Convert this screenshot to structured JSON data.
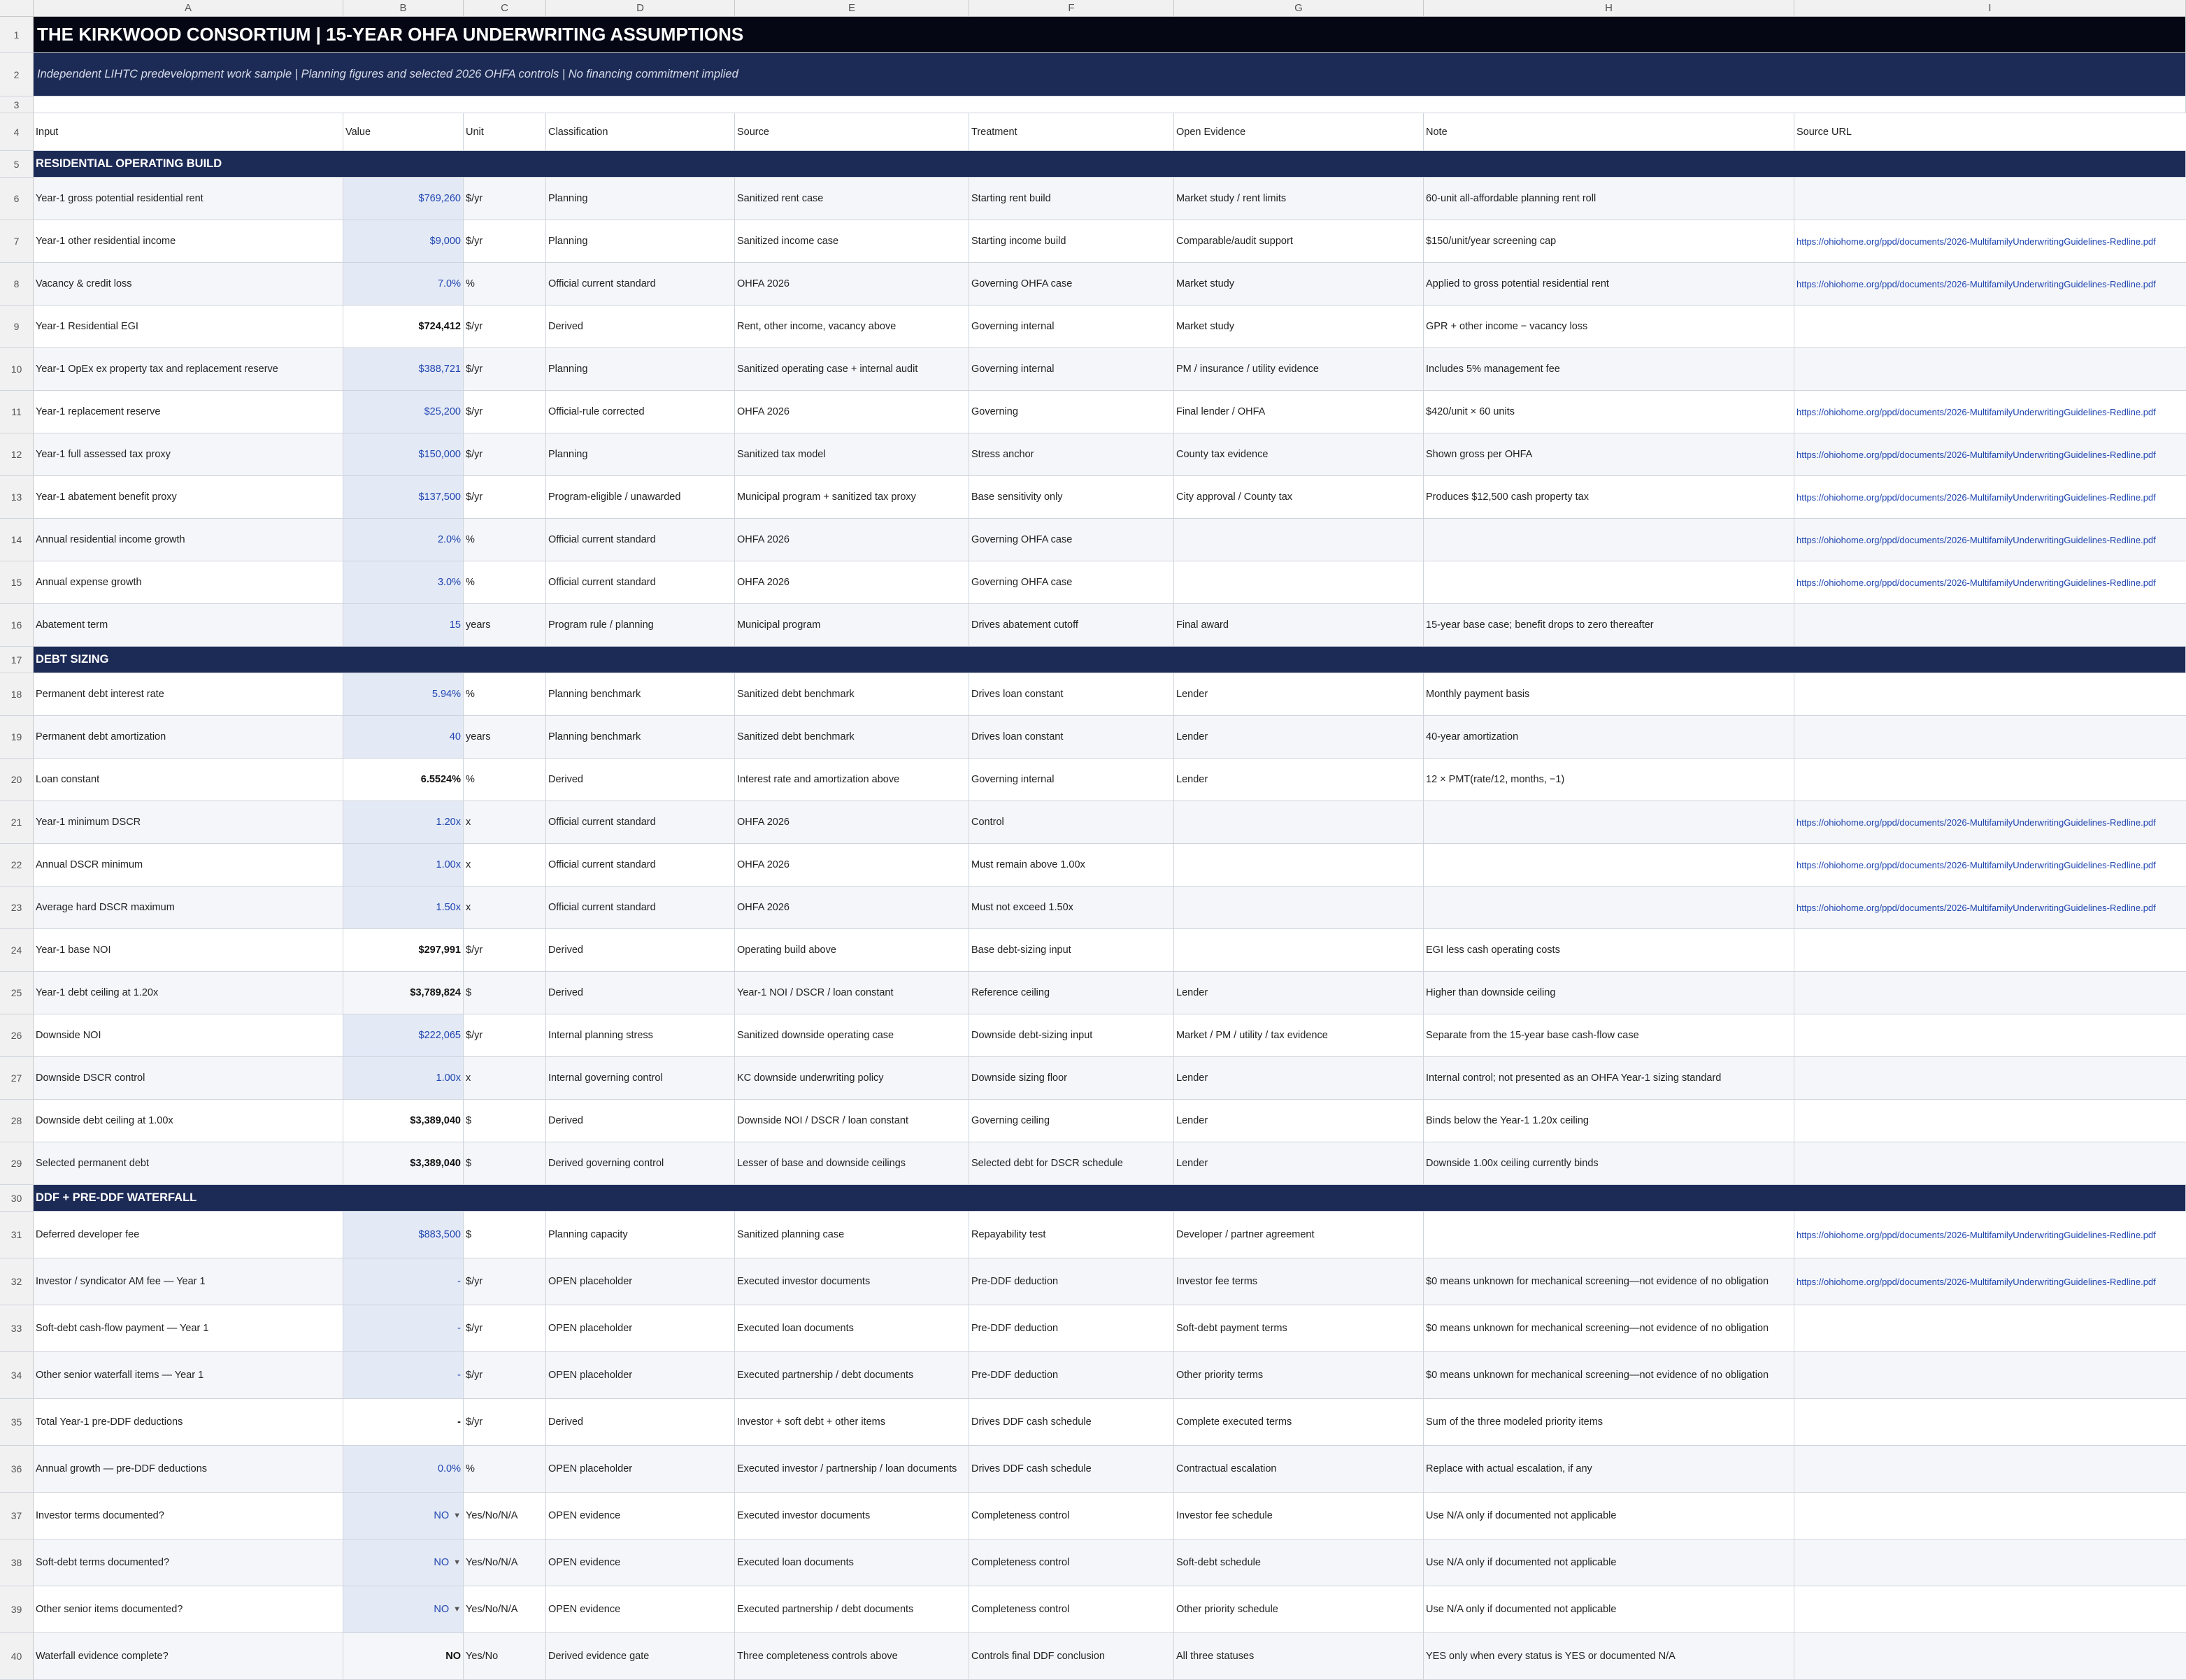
{
  "columns": [
    "A",
    "B",
    "C",
    "D",
    "E",
    "F",
    "G",
    "H",
    "I"
  ],
  "title": "THE KIRKWOOD CONSORTIUM | 15-YEAR OHFA UNDERWRITING ASSUMPTIONS",
  "subtitle": "Independent LIHTC predevelopment work sample | Planning figures and selected 2026 OHFA controls | No financing commitment implied",
  "headers": [
    "Input",
    "Value",
    "Unit",
    "Classification",
    "Source",
    "Treatment",
    "Open Evidence",
    "Note",
    "Source URL"
  ],
  "url": "https://ohiohome.org/ppd/documents/2026-MultifamilyUnderwritingGuidelines-Redline.pdf",
  "rows": [
    {
      "n": "1",
      "kind": "title"
    },
    {
      "n": "2",
      "kind": "subtitle"
    },
    {
      "n": "3",
      "kind": "blank"
    },
    {
      "n": "4",
      "kind": "header"
    },
    {
      "n": "5",
      "kind": "section",
      "label": "RESIDENTIAL OPERATING BUILD"
    },
    {
      "n": "6",
      "kind": "data",
      "input": "Year-1 gross potential residential rent",
      "value": "$769,260",
      "vstyle": "input",
      "unit": "$/yr",
      "cls": "Planning",
      "source": "Sanitized rent case",
      "treatment": "Starting rent build",
      "evidence": "Market study / rent limits",
      "note": "60-unit all-affordable planning rent roll",
      "url": ""
    },
    {
      "n": "7",
      "kind": "data",
      "input": "Year-1 other residential income",
      "value": "$9,000",
      "vstyle": "input",
      "unit": "$/yr",
      "cls": "Planning",
      "source": "Sanitized income case",
      "treatment": "Starting income build",
      "evidence": "Comparable/audit support",
      "note": "$150/unit/year screening cap",
      "url": "https://ohiohome.org/ppd/documents/2026-MultifamilyUnderwritingGuidelines-Redline.pdf"
    },
    {
      "n": "8",
      "kind": "data",
      "input": "Vacancy & credit loss",
      "value": "7.0%",
      "vstyle": "input",
      "unit": "%",
      "cls": "Official current standard",
      "source": "OHFA 2026",
      "treatment": "Governing OHFA case",
      "evidence": "Market study",
      "note": "Applied to gross potential residential rent",
      "url": "https://ohiohome.org/ppd/documents/2026-MultifamilyUnderwritingGuidelines-Redline.pdf"
    },
    {
      "n": "9",
      "kind": "data",
      "input": "Year-1 Residential EGI",
      "value": "$724,412",
      "vstyle": "derived",
      "unit": "$/yr",
      "cls": "Derived",
      "source": "Rent, other income, vacancy above",
      "treatment": "Governing internal",
      "evidence": "Market study",
      "note": "GPR + other income − vacancy loss",
      "url": ""
    },
    {
      "n": "10",
      "kind": "data",
      "input": "Year-1 OpEx ex property tax and replacement reserve",
      "value": "$388,721",
      "vstyle": "input",
      "unit": "$/yr",
      "cls": "Planning",
      "source": "Sanitized operating case + internal audit",
      "treatment": "Governing internal",
      "evidence": "PM / insurance / utility evidence",
      "note": "Includes 5% management fee",
      "url": ""
    },
    {
      "n": "11",
      "kind": "data",
      "input": "Year-1 replacement reserve",
      "value": "$25,200",
      "vstyle": "input",
      "unit": "$/yr",
      "cls": "Official-rule corrected",
      "source": "OHFA 2026",
      "treatment": "Governing",
      "evidence": "Final lender / OHFA",
      "note": "$420/unit × 60 units",
      "url": "https://ohiohome.org/ppd/documents/2026-MultifamilyUnderwritingGuidelines-Redline.pdf"
    },
    {
      "n": "12",
      "kind": "data",
      "input": "Year-1 full assessed tax proxy",
      "value": "$150,000",
      "vstyle": "input",
      "unit": "$/yr",
      "cls": "Planning",
      "source": "Sanitized tax model",
      "treatment": "Stress anchor",
      "evidence": "County tax evidence",
      "note": "Shown gross per OHFA",
      "url": "https://ohiohome.org/ppd/documents/2026-MultifamilyUnderwritingGuidelines-Redline.pdf"
    },
    {
      "n": "13",
      "kind": "data",
      "input": "Year-1 abatement benefit proxy",
      "value": "$137,500",
      "vstyle": "input",
      "unit": "$/yr",
      "cls": "Program-eligible / unawarded",
      "source": "Municipal program + sanitized tax proxy",
      "treatment": "Base sensitivity only",
      "evidence": "City approval / County tax",
      "note": "Produces $12,500 cash property tax",
      "url": "https://ohiohome.org/ppd/documents/2026-MultifamilyUnderwritingGuidelines-Redline.pdf"
    },
    {
      "n": "14",
      "kind": "data",
      "input": "Annual residential income growth",
      "value": "2.0%",
      "vstyle": "input",
      "unit": "%",
      "cls": "Official current standard",
      "source": "OHFA 2026",
      "treatment": "Governing OHFA case",
      "evidence": "",
      "note": "",
      "url": "https://ohiohome.org/ppd/documents/2026-MultifamilyUnderwritingGuidelines-Redline.pdf"
    },
    {
      "n": "15",
      "kind": "data",
      "input": "Annual expense growth",
      "value": "3.0%",
      "vstyle": "input",
      "unit": "%",
      "cls": "Official current standard",
      "source": "OHFA 2026",
      "treatment": "Governing OHFA case",
      "evidence": "",
      "note": "",
      "url": "https://ohiohome.org/ppd/documents/2026-MultifamilyUnderwritingGuidelines-Redline.pdf"
    },
    {
      "n": "16",
      "kind": "data",
      "input": "Abatement term",
      "value": "15",
      "vstyle": "input",
      "unit": "years",
      "cls": "Program rule / planning",
      "source": "Municipal program",
      "treatment": "Drives abatement cutoff",
      "evidence": "Final award",
      "note": "15-year base case; benefit drops to zero thereafter",
      "url": ""
    },
    {
      "n": "17",
      "kind": "section",
      "label": "DEBT SIZING"
    },
    {
      "n": "18",
      "kind": "data",
      "input": "Permanent debt interest rate",
      "value": "5.94%",
      "vstyle": "input",
      "unit": "%",
      "cls": "Planning benchmark",
      "source": "Sanitized debt benchmark",
      "treatment": "Drives loan constant",
      "evidence": "Lender",
      "note": "Monthly payment basis",
      "url": ""
    },
    {
      "n": "19",
      "kind": "data",
      "input": "Permanent debt amortization",
      "value": "40",
      "vstyle": "input",
      "unit": "years",
      "cls": "Planning benchmark",
      "source": "Sanitized debt benchmark",
      "treatment": "Drives loan constant",
      "evidence": "Lender",
      "note": "40-year amortization",
      "url": ""
    },
    {
      "n": "20",
      "kind": "data",
      "input": "Loan constant",
      "value": "6.5524%",
      "vstyle": "derived",
      "unit": "%",
      "cls": "Derived",
      "source": "Interest rate and amortization above",
      "treatment": "Governing internal",
      "evidence": "Lender",
      "note": "12 × PMT(rate/12, months, −1)",
      "url": ""
    },
    {
      "n": "21",
      "kind": "data",
      "input": "Year-1 minimum DSCR",
      "value": "1.20x",
      "vstyle": "input",
      "unit": "x",
      "cls": "Official current standard",
      "source": "OHFA 2026",
      "treatment": "Control",
      "evidence": "",
      "note": "",
      "url": "https://ohiohome.org/ppd/documents/2026-MultifamilyUnderwritingGuidelines-Redline.pdf"
    },
    {
      "n": "22",
      "kind": "data",
      "input": "Annual DSCR minimum",
      "value": "1.00x",
      "vstyle": "input",
      "unit": "x",
      "cls": "Official current standard",
      "source": "OHFA 2026",
      "treatment": "Must remain above 1.00x",
      "evidence": "",
      "note": "",
      "url": "https://ohiohome.org/ppd/documents/2026-MultifamilyUnderwritingGuidelines-Redline.pdf"
    },
    {
      "n": "23",
      "kind": "data",
      "input": "Average hard DSCR maximum",
      "value": "1.50x",
      "vstyle": "input",
      "unit": "x",
      "cls": "Official current standard",
      "source": "OHFA 2026",
      "treatment": "Must not exceed 1.50x",
      "evidence": "",
      "note": "",
      "url": "https://ohiohome.org/ppd/documents/2026-MultifamilyUnderwritingGuidelines-Redline.pdf"
    },
    {
      "n": "24",
      "kind": "data",
      "input": "Year-1 base NOI",
      "value": "$297,991",
      "vstyle": "derived",
      "unit": "$/yr",
      "cls": "Derived",
      "source": "Operating build above",
      "treatment": "Base debt-sizing input",
      "evidence": "",
      "note": "EGI less cash operating costs",
      "url": ""
    },
    {
      "n": "25",
      "kind": "data",
      "input": "Year-1 debt ceiling at 1.20x",
      "value": "$3,789,824",
      "vstyle": "derived",
      "unit": "$",
      "cls": "Derived",
      "source": "Year-1 NOI / DSCR / loan constant",
      "treatment": "Reference ceiling",
      "evidence": "Lender",
      "note": "Higher than downside ceiling",
      "url": ""
    },
    {
      "n": "26",
      "kind": "data",
      "input": "Downside NOI",
      "value": "$222,065",
      "vstyle": "input",
      "unit": "$/yr",
      "cls": "Internal planning stress",
      "source": "Sanitized downside operating case",
      "treatment": "Downside debt-sizing input",
      "evidence": "Market / PM / utility / tax evidence",
      "note": "Separate from the 15-year base cash-flow case",
      "url": ""
    },
    {
      "n": "27",
      "kind": "data",
      "input": "Downside DSCR control",
      "value": "1.00x",
      "vstyle": "input",
      "unit": "x",
      "cls": "Internal governing control",
      "source": "KC downside underwriting policy",
      "treatment": "Downside sizing floor",
      "evidence": "Lender",
      "note": "Internal control; not presented as an OHFA Year-1 sizing standard",
      "url": ""
    },
    {
      "n": "28",
      "kind": "data",
      "input": "Downside debt ceiling at 1.00x",
      "value": "$3,389,040",
      "vstyle": "derived",
      "unit": "$",
      "cls": "Derived",
      "source": "Downside NOI / DSCR / loan constant",
      "treatment": "Governing ceiling",
      "evidence": "Lender",
      "note": "Binds below the Year-1 1.20x ceiling",
      "url": ""
    },
    {
      "n": "29",
      "kind": "data",
      "input": "Selected permanent debt",
      "value": "$3,389,040",
      "vstyle": "derived",
      "unit": "$",
      "cls": "Derived governing control",
      "source": "Lesser of base and downside ceilings",
      "treatment": "Selected debt for DSCR schedule",
      "evidence": "Lender",
      "note": "Downside 1.00x ceiling currently binds",
      "url": ""
    },
    {
      "n": "30",
      "kind": "section",
      "label": "DDF + PRE-DDF WATERFALL"
    },
    {
      "n": "31",
      "kind": "data",
      "input": "Deferred developer fee",
      "value": "$883,500",
      "vstyle": "input",
      "unit": "$",
      "cls": "Planning capacity",
      "source": "Sanitized planning case",
      "treatment": "Repayability test",
      "evidence": "Developer / partner agreement",
      "note": "",
      "url": "https://ohiohome.org/ppd/documents/2026-MultifamilyUnderwritingGuidelines-Redline.pdf"
    },
    {
      "n": "32",
      "kind": "data",
      "input": "Investor / syndicator AM fee — Year 1",
      "value": "-",
      "vstyle": "input",
      "unit": "$/yr",
      "cls": "OPEN placeholder",
      "source": "Executed investor documents",
      "treatment": "Pre-DDF deduction",
      "evidence": "Investor fee terms",
      "note": "$0 means unknown for mechanical screening—not evidence of no obligation",
      "url": "https://ohiohome.org/ppd/documents/2026-MultifamilyUnderwritingGuidelines-Redline.pdf"
    },
    {
      "n": "33",
      "kind": "data",
      "input": "Soft-debt cash-flow payment — Year 1",
      "value": "-",
      "vstyle": "input",
      "unit": "$/yr",
      "cls": "OPEN placeholder",
      "source": "Executed loan documents",
      "treatment": "Pre-DDF deduction",
      "evidence": "Soft-debt payment terms",
      "note": "$0 means unknown for mechanical screening—not evidence of no obligation",
      "url": ""
    },
    {
      "n": "34",
      "kind": "data",
      "input": "Other senior waterfall items — Year 1",
      "value": "-",
      "vstyle": "input",
      "unit": "$/yr",
      "cls": "OPEN placeholder",
      "source": "Executed partnership / debt documents",
      "treatment": "Pre-DDF deduction",
      "evidence": "Other priority terms",
      "note": "$0 means unknown for mechanical screening—not evidence of no obligation",
      "url": ""
    },
    {
      "n": "35",
      "kind": "data",
      "input": "Total Year-1 pre-DDF deductions",
      "value": "-",
      "vstyle": "derived",
      "unit": "$/yr",
      "cls": "Derived",
      "source": "Investor + soft debt + other items",
      "treatment": "Drives DDF cash schedule",
      "evidence": "Complete executed terms",
      "note": "Sum of the three modeled priority items",
      "url": ""
    },
    {
      "n": "36",
      "kind": "data",
      "input": "Annual growth — pre-DDF deductions",
      "value": "0.0%",
      "vstyle": "input",
      "unit": "%",
      "cls": "OPEN placeholder",
      "source": "Executed investor / partnership / loan documents",
      "treatment": "Drives DDF cash schedule",
      "evidence": "Contractual escalation",
      "note": "Replace with actual escalation, if any",
      "url": ""
    },
    {
      "n": "37",
      "kind": "data",
      "input": "Investor terms documented?",
      "value": "NO",
      "vstyle": "input",
      "dropdown": true,
      "unit": "Yes/No/N/A",
      "cls": "OPEN evidence",
      "source": "Executed investor documents",
      "treatment": "Completeness control",
      "evidence": "Investor fee schedule",
      "note": "Use N/A only if documented not applicable",
      "url": ""
    },
    {
      "n": "38",
      "kind": "data",
      "input": "Soft-debt terms documented?",
      "value": "NO",
      "vstyle": "input",
      "dropdown": true,
      "unit": "Yes/No/N/A",
      "cls": "OPEN evidence",
      "source": "Executed loan documents",
      "treatment": "Completeness control",
      "evidence": "Soft-debt schedule",
      "note": "Use N/A only if documented not applicable",
      "url": ""
    },
    {
      "n": "39",
      "kind": "data",
      "input": "Other senior items documented?",
      "value": "NO",
      "vstyle": "input",
      "dropdown": true,
      "unit": "Yes/No/N/A",
      "cls": "OPEN evidence",
      "source": "Executed partnership / debt documents",
      "treatment": "Completeness control",
      "evidence": "Other priority schedule",
      "note": "Use N/A only if documented not applicable",
      "url": ""
    },
    {
      "n": "40",
      "kind": "data",
      "input": "Waterfall evidence complete?",
      "value": "NO",
      "vstyle": "derived",
      "unit": "Yes/No",
      "cls": "Derived evidence gate",
      "source": "Three completeness controls above",
      "treatment": "Controls final DDF conclusion",
      "evidence": "All three statuses",
      "note": "YES only when every status is YES or documented N/A",
      "url": ""
    }
  ]
}
